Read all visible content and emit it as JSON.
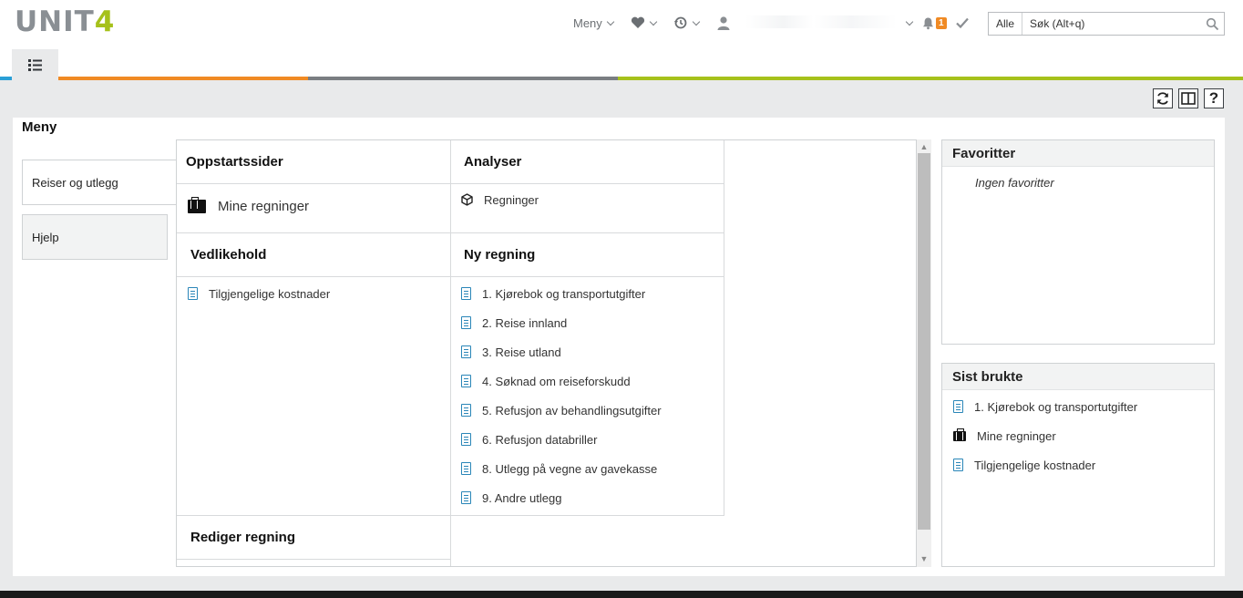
{
  "header": {
    "logo_text": "UNIT",
    "logo_digit": "4",
    "menu_label": "Meny",
    "notifications_count": "1",
    "search": {
      "scope": "Alle",
      "placeholder": "Søk (Alt+q)"
    }
  },
  "brand_colors": {
    "orange": "#f08a24",
    "gray": "#7a7e82",
    "green": "#a6c11b",
    "blue": "#2a9fd6",
    "doc_icon": "#2a86b8"
  },
  "main": {
    "title": "Meny",
    "left_tabs": [
      {
        "label": "Reiser og utlegg",
        "active": true
      },
      {
        "label": "Hjelp",
        "active": false
      }
    ],
    "sections": {
      "oppstart": {
        "title": "Oppstartssider",
        "items": [
          {
            "label": "Mine regninger",
            "icon": "briefcase-icon"
          }
        ]
      },
      "analyser": {
        "title": "Analyser",
        "items": [
          {
            "label": "Regninger",
            "icon": "cube-icon"
          }
        ]
      },
      "vedlikehold": {
        "title": "Vedlikehold",
        "items": [
          {
            "label": "Tilgjengelige kostnader",
            "icon": "document-icon"
          }
        ]
      },
      "ny_regning": {
        "title": "Ny regning",
        "items": [
          {
            "label": "1. Kjørebok og transportutgifter"
          },
          {
            "label": "2. Reise innland"
          },
          {
            "label": "3. Reise utland"
          },
          {
            "label": "4. Søknad om reiseforskudd"
          },
          {
            "label": "5. Refusjon av behandlingsutgifter"
          },
          {
            "label": "6. Refusjon databriller"
          },
          {
            "label": "8. Utlegg på vegne av gavekasse"
          },
          {
            "label": "9. Andre utlegg"
          }
        ]
      },
      "rediger": {
        "title": "Rediger regning"
      }
    }
  },
  "favorites": {
    "title": "Favoritter",
    "empty_text": "Ingen favoritter"
  },
  "recent": {
    "title": "Sist brukte",
    "items": [
      {
        "label": "1. Kjørebok og transportutgifter",
        "icon": "document-icon"
      },
      {
        "label": "Mine regninger",
        "icon": "briefcase-icon"
      },
      {
        "label": "Tilgjengelige kostnader",
        "icon": "document-icon"
      }
    ]
  }
}
